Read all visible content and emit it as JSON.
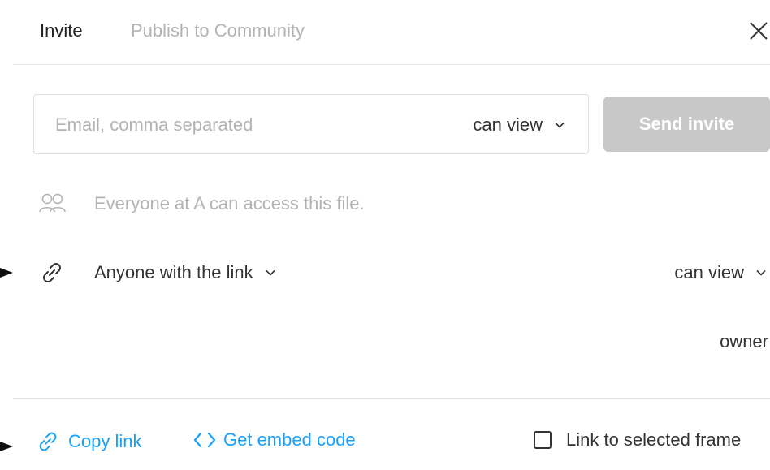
{
  "tabs": {
    "invite": "Invite",
    "publish": "Publish to Community"
  },
  "invite": {
    "email_placeholder": "Email, comma separated",
    "email_value": "",
    "permission": "can view",
    "send_label": "Send invite"
  },
  "team_access": {
    "text": "Everyone at A can access this file."
  },
  "link_access": {
    "scope_label": "Anyone with the link",
    "permission": "can view"
  },
  "member": {
    "role": "owner"
  },
  "footer": {
    "copy_link": "Copy link",
    "embed_code": "Get embed code",
    "link_selected_frame": "Link to selected frame",
    "link_selected_frame_checked": false
  },
  "colors": {
    "link_blue": "#18a0fb",
    "disabled_button": "#c8c8c8",
    "muted_text": "#b3b3b3",
    "text": "#333333"
  },
  "icons": [
    "close-icon",
    "chevron-down-icon",
    "people-icon",
    "link-icon",
    "code-icon",
    "checkbox-icon",
    "arrow-marker-icon"
  ]
}
